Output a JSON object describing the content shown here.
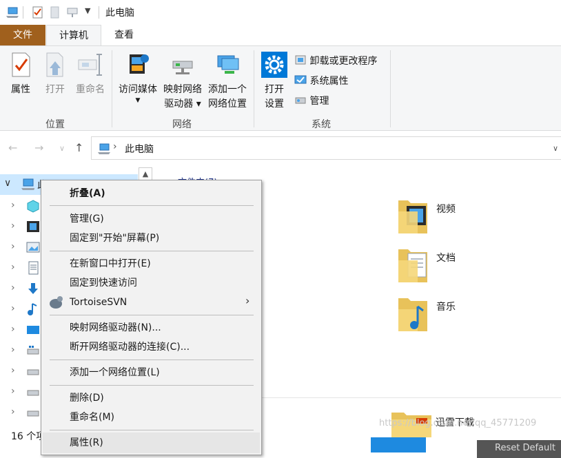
{
  "window": {
    "title": "此电脑"
  },
  "ribbon": {
    "tabs": [
      "文件",
      "计算机",
      "查看"
    ],
    "groups": [
      {
        "label": "位置",
        "buttons": [
          "属性",
          "打开",
          "重命名"
        ]
      },
      {
        "label": "网络",
        "buttons": [
          [
            "访问媒体"
          ],
          [
            "映射网络",
            "驱动器 ▾"
          ],
          [
            "添加一个",
            "网络位置"
          ]
        ]
      },
      {
        "label": "系统",
        "buttons": [
          [
            "打开",
            "设置"
          ]
        ],
        "small_items": [
          "卸载或更改程序",
          "系统属性",
          "管理"
        ]
      }
    ]
  },
  "address": {
    "path": "此电脑"
  },
  "nav": {
    "pc_label": "此",
    "status": "16 个项"
  },
  "content": {
    "header_partial": "文件夹(7)",
    "folders": [
      "视频",
      "文档",
      "音乐"
    ],
    "download_folder": "迅雷下载",
    "watermark": "https://blog.csdn.net/qq_45771209",
    "reset_label": "Reset Default"
  },
  "context_menu": {
    "items": [
      {
        "label": "折叠(A)",
        "bold": true
      },
      {
        "label": "管理(G)"
      },
      {
        "label": "固定到\"开始\"屏幕(P)"
      },
      {
        "label": "在新窗口中打开(E)"
      },
      {
        "label": "固定到快速访问"
      },
      {
        "label": "TortoiseSVN",
        "submenu": true
      },
      {
        "label": "映射网络驱动器(N)..."
      },
      {
        "label": "断开网络驱动器的连接(C)..."
      },
      {
        "label": "添加一个网络位置(L)"
      },
      {
        "label": "删除(D)"
      },
      {
        "label": "重命名(M)"
      },
      {
        "label": "属性(R)"
      }
    ]
  },
  "colors": {
    "file_tab": "#a0601d",
    "selection": "#cce8ff",
    "settings_blue": "#0078d7"
  }
}
